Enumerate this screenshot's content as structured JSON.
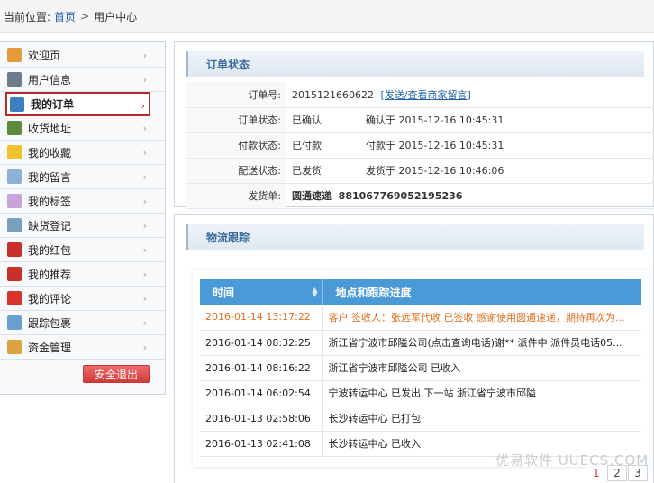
{
  "breadcrumb": {
    "prefix": "当前位置:",
    "home": "首页",
    "sep": ">",
    "current": "用户中心"
  },
  "sidebar": {
    "items": [
      {
        "label": "欢迎页",
        "icon": "home-icon",
        "color": "#e59b3a"
      },
      {
        "label": "用户信息",
        "icon": "id-card-icon",
        "color": "#6b7d8c"
      },
      {
        "label": "我的订单",
        "icon": "order-doc-icon",
        "color": "#3d7fc0",
        "active": true
      },
      {
        "label": "收货地址",
        "icon": "address-book-icon",
        "color": "#5b8a3c"
      },
      {
        "label": "我的收藏",
        "icon": "star-icon",
        "color": "#f2c12e"
      },
      {
        "label": "我的留言",
        "icon": "chat-bubble-icon",
        "color": "#8fb0d6"
      },
      {
        "label": "我的标签",
        "icon": "tag-icon",
        "color": "#c9a3d9"
      },
      {
        "label": "缺货登记",
        "icon": "register-icon",
        "color": "#7aa0c0"
      },
      {
        "label": "我的红包",
        "icon": "red-packet-icon",
        "color": "#c9302c"
      },
      {
        "label": "我的推荐",
        "icon": "recommend-icon",
        "color": "#c9302c"
      },
      {
        "label": "我的评论",
        "icon": "flag-icon",
        "color": "#d9342b"
      },
      {
        "label": "跟踪包裹",
        "icon": "track-icon",
        "color": "#6a9fd1"
      },
      {
        "label": "资金管理",
        "icon": "wallet-icon",
        "color": "#d9a441"
      }
    ],
    "logout_label": "安全退出"
  },
  "order_status": {
    "title": "订单状态",
    "rows": [
      {
        "key": "订单号:",
        "value": "2015121660622",
        "link": "[发送/查看商家留言]"
      },
      {
        "key": "订单状态:",
        "value": "已确认",
        "extra": "确认于 2015-12-16 10:45:31"
      },
      {
        "key": "付款状态:",
        "value": "已付款",
        "extra": "付款于 2015-12-16 10:45:31"
      },
      {
        "key": "配送状态:",
        "value": "已发货",
        "extra": "发货于 2015-12-16 10:46:06"
      },
      {
        "key": "发货单:",
        "value": "圆通速递",
        "extra": "881067769052195236"
      }
    ]
  },
  "logistics": {
    "title": "物流跟踪",
    "columns": [
      "时间",
      "地点和跟踪进度"
    ],
    "rows": [
      {
        "time": "2016-01-14 13:17:22",
        "text": "客户 签收人：张远军代收 已签收 感谢使用圆通速递，期待再次为...",
        "highlight": true
      },
      {
        "time": "2016-01-14 08:32:25",
        "text": "浙江省宁波市邱隘公司(点击查询电话)谢** 派件中 派件员电话05..."
      },
      {
        "time": "2016-01-14 08:16:22",
        "text": "浙江省宁波市邱隘公司 已收入"
      },
      {
        "time": "2016-01-14 06:02:54",
        "text": "宁波转运中心 已发出,下一站 浙江省宁波市邱隘"
      },
      {
        "time": "2016-01-13 02:58:06",
        "text": "长沙转运中心 已打包"
      },
      {
        "time": "2016-01-13 02:41:08",
        "text": "长沙转运中心 已收入"
      }
    ],
    "pages": [
      "1",
      "2",
      "3"
    ],
    "current_page": "1"
  },
  "watermark": "优易软件 UUECS.COM",
  "colors": {
    "accent": "#4a9ad8",
    "active_border": "#b32b2b",
    "highlight_text": "#e06f1f",
    "link": "#1f5fa8"
  }
}
